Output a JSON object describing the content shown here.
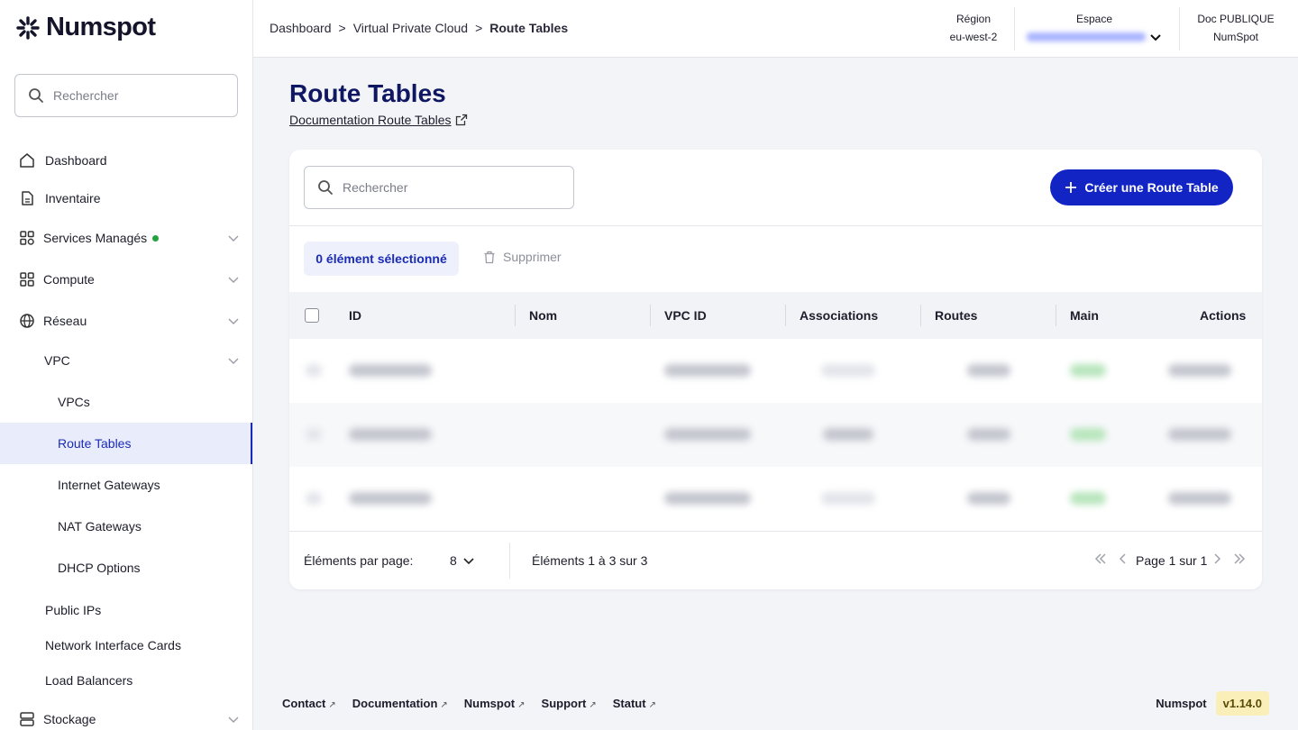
{
  "brand": {
    "name": "Numspot"
  },
  "sidebar": {
    "search_placeholder": "Rechercher",
    "items": {
      "dashboard": "Dashboard",
      "inventaire": "Inventaire",
      "services": "Services Managés",
      "compute": "Compute",
      "reseau": "Réseau",
      "vpc": "VPC",
      "vpcs": "VPCs",
      "route_tables": "Route Tables",
      "internet_gateways": "Internet Gateways",
      "nat_gateways": "NAT Gateways",
      "dhcp_options": "DHCP Options",
      "public_ips": "Public IPs",
      "nic": "Network Interface Cards",
      "load_balancers": "Load Balancers",
      "stockage": "Stockage"
    }
  },
  "header": {
    "breadcrumb": [
      "Dashboard",
      ">",
      "Virtual Private Cloud",
      ">",
      "Route Tables"
    ],
    "region_label": "Région",
    "region_value": "eu-west-2",
    "espace_label": "Espace",
    "doc_label": "Doc PUBLIQUE",
    "doc_value": "NumSpot"
  },
  "main": {
    "title": "Route Tables",
    "doc_link": "Documentation Route Tables",
    "search_placeholder": "Rechercher",
    "create_button": "Créer une Route Table",
    "selected_chip": "0 élément sélectionné",
    "delete_button": "Supprimer",
    "columns": [
      "ID",
      "Nom",
      "VPC ID",
      "Associations",
      "Routes",
      "Main",
      "Actions"
    ],
    "pager": {
      "per_page_label": "Éléments par page:",
      "per_page_value": "8",
      "range": "Éléments 1 à 3 sur 3",
      "page": "Page 1 sur 1"
    }
  },
  "footer": {
    "links": [
      "Contact",
      "Documentation",
      "Numspot",
      "Support",
      "Statut"
    ],
    "brand": "Numspot",
    "version": "v1.14.0"
  },
  "colors": {
    "primary": "#1225c4",
    "title": "#0f1762",
    "active_bg": "#e9edfb",
    "badge": "#fbefb9"
  }
}
